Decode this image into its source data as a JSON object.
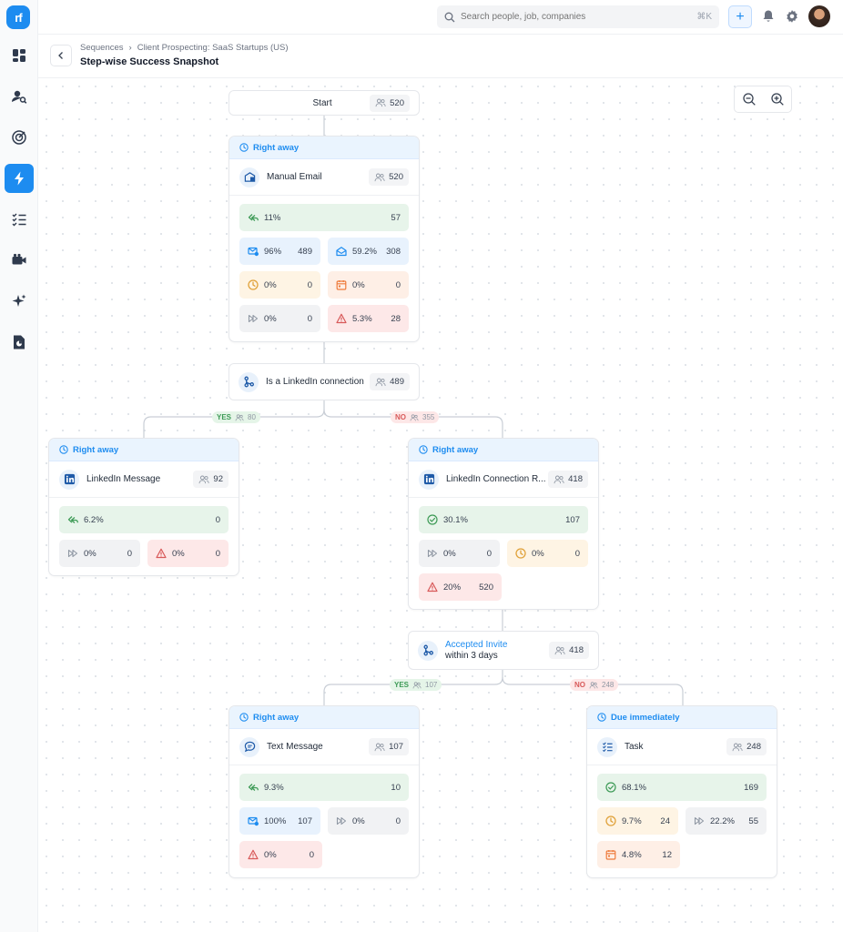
{
  "topbar": {
    "search_placeholder": "Search people, job, companies",
    "search_shortcut": "⌘K",
    "add_label": "+"
  },
  "breadcrumb": [
    "Sequences",
    "Client Prospecting: SaaS Startups (US)"
  ],
  "page_title": "Step-wise Success Snapshot",
  "colors": {
    "accent": "#1d8cf0",
    "success": "#3c9a55",
    "danger": "#d85a5a"
  },
  "flow": {
    "start": {
      "label": "Start",
      "count": "520"
    },
    "manual_email": {
      "timing": "Right away",
      "label": "Manual Email",
      "count": "520",
      "reply": {
        "pct": "11%",
        "val": "57"
      },
      "delivered": {
        "pct": "96%",
        "val": "489"
      },
      "opened": {
        "pct": "59.2%",
        "val": "308"
      },
      "pending": {
        "pct": "0%",
        "val": "0"
      },
      "scheduled": {
        "pct": "0%",
        "val": "0"
      },
      "skipped": {
        "pct": "0%",
        "val": "0"
      },
      "bounced": {
        "pct": "5.3%",
        "val": "28"
      }
    },
    "condition1": {
      "label": "Is a LinkedIn connection",
      "count": "489",
      "yes": {
        "label": "YES",
        "count": "80"
      },
      "no": {
        "label": "NO",
        "count": "355"
      }
    },
    "linkedin_message": {
      "timing": "Right away",
      "label": "LinkedIn Message",
      "count": "92",
      "reply": {
        "pct": "6.2%",
        "val": "0"
      },
      "skipped": {
        "pct": "0%",
        "val": "0"
      },
      "failed": {
        "pct": "0%",
        "val": "0"
      }
    },
    "linkedin_connection": {
      "timing": "Right away",
      "label": "LinkedIn Connection R...",
      "count": "418",
      "accepted": {
        "pct": "30.1%",
        "val": "107"
      },
      "skipped": {
        "pct": "0%",
        "val": "0"
      },
      "pending": {
        "pct": "0%",
        "val": "0"
      },
      "failed": {
        "pct": "20%",
        "val": "520"
      }
    },
    "condition2": {
      "label1": "Accepted Invite",
      "label2": "within 3 days",
      "count": "418",
      "yes": {
        "label": "YES",
        "count": "107"
      },
      "no": {
        "label": "NO",
        "count": "248"
      }
    },
    "text_message": {
      "timing": "Right away",
      "label": "Text Message",
      "count": "107",
      "reply": {
        "pct": "9.3%",
        "val": "10"
      },
      "delivered": {
        "pct": "100%",
        "val": "107"
      },
      "skipped": {
        "pct": "0%",
        "val": "0"
      },
      "failed": {
        "pct": "0%",
        "val": "0"
      }
    },
    "task": {
      "timing": "Due immediately",
      "label": "Task",
      "count": "248",
      "completed": {
        "pct": "68.1%",
        "val": "169"
      },
      "pending": {
        "pct": "9.7%",
        "val": "24"
      },
      "skipped": {
        "pct": "22.2%",
        "val": "55"
      },
      "scheduled": {
        "pct": "4.8%",
        "val": "12"
      }
    }
  }
}
